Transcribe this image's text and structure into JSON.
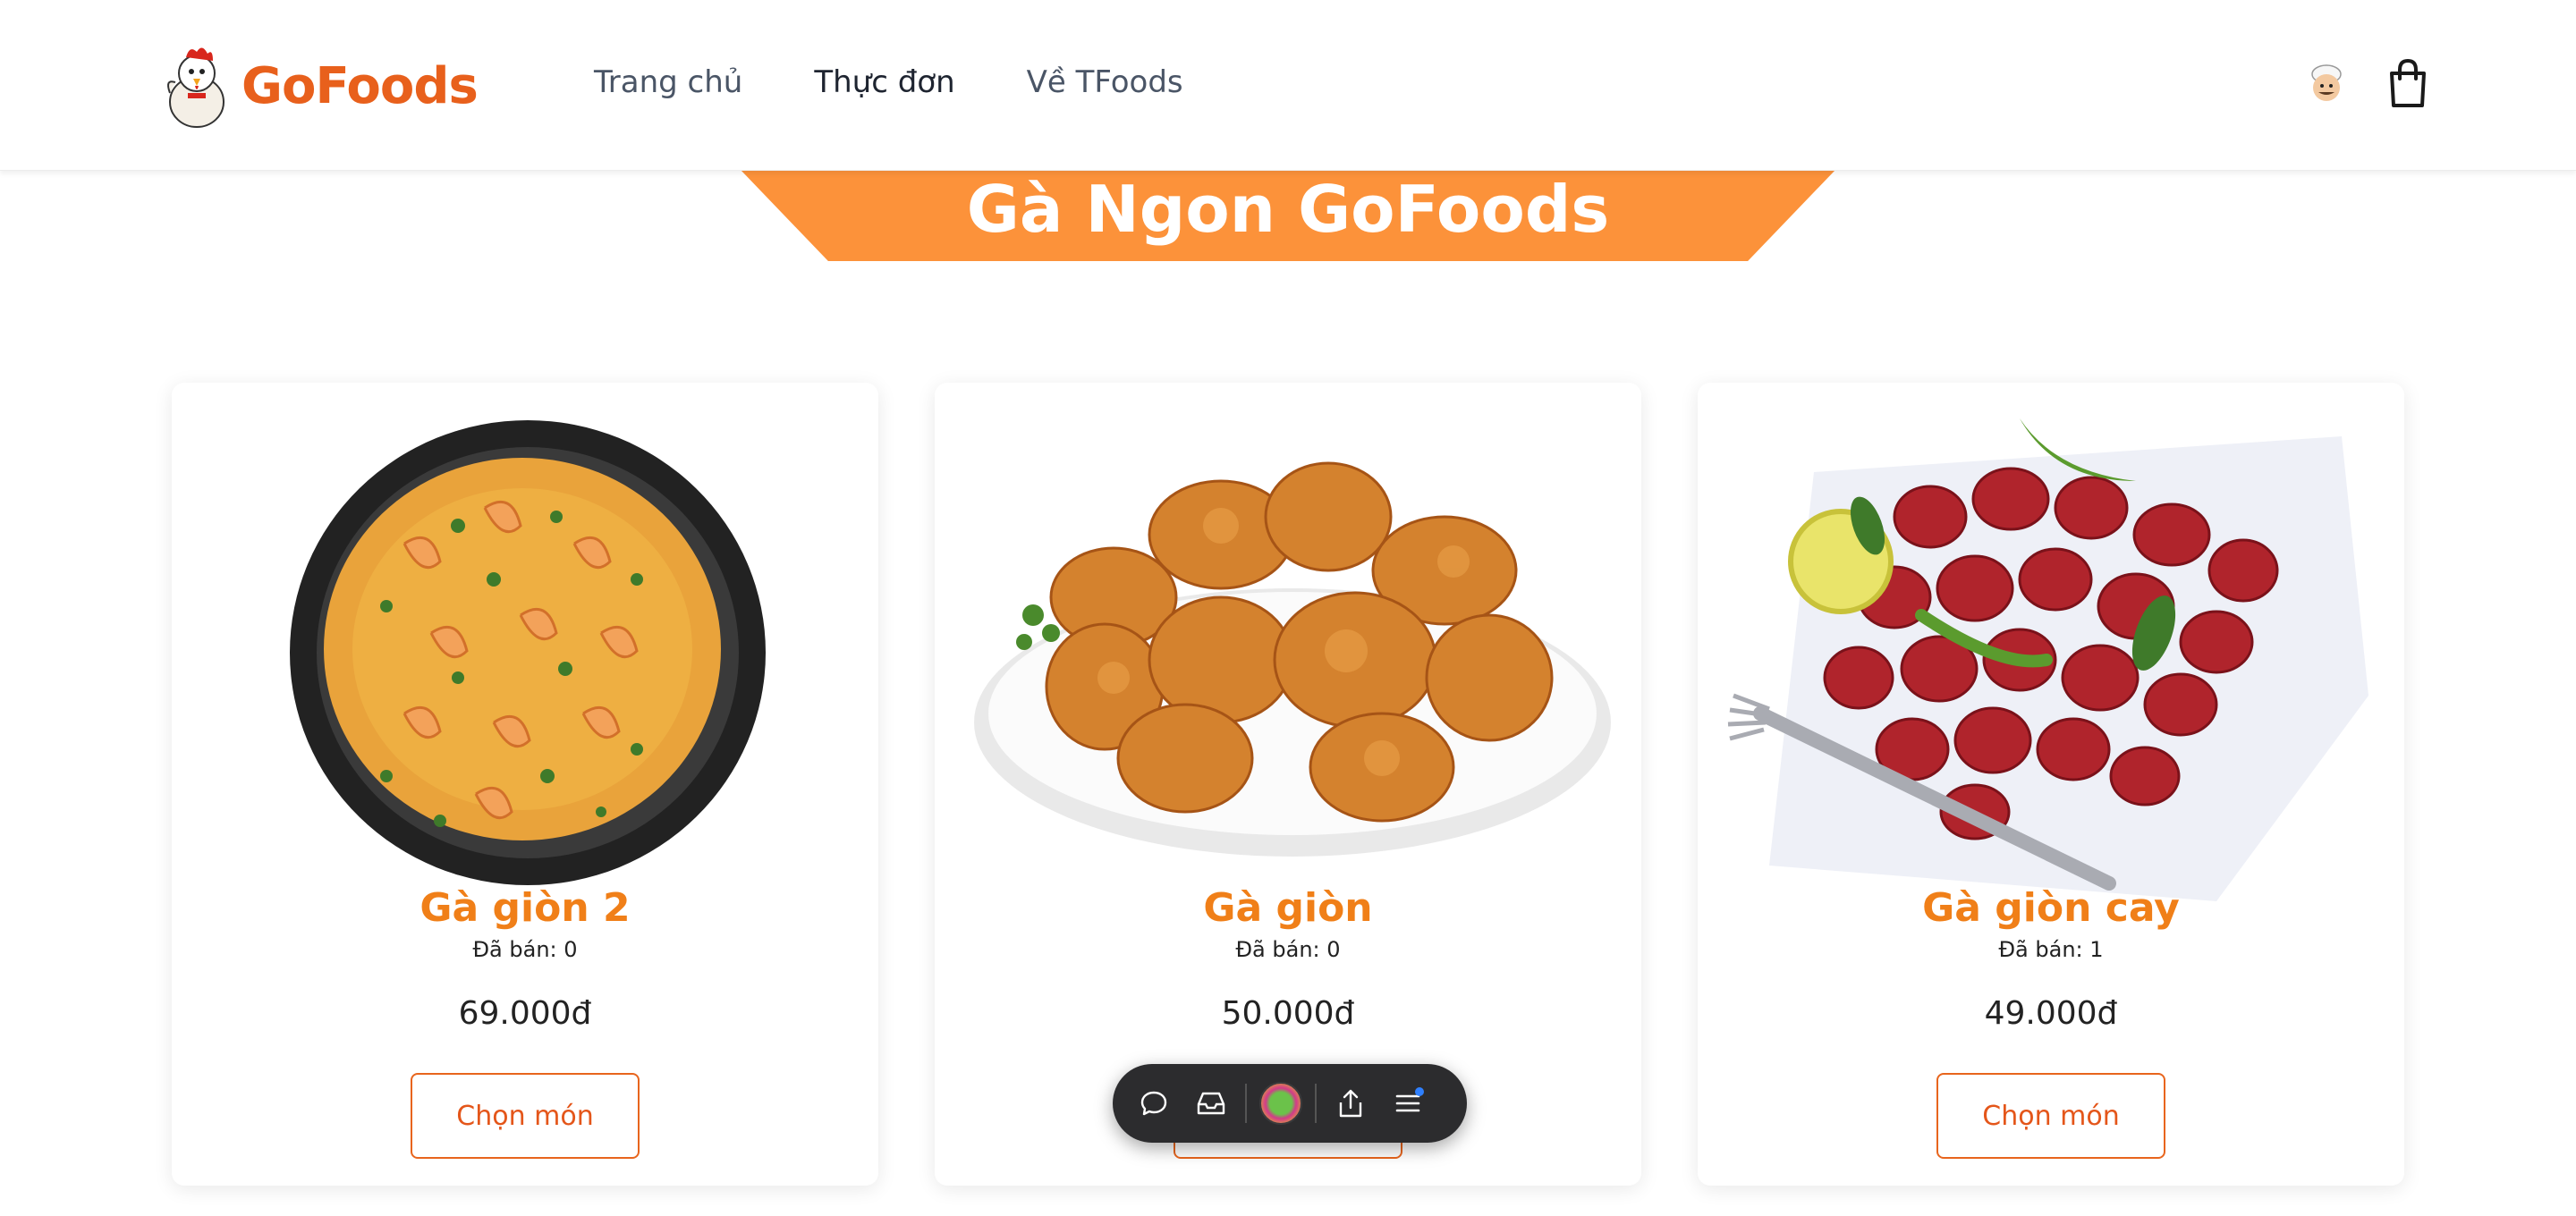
{
  "header": {
    "brand": "GoFoods",
    "nav": [
      {
        "label": "Trang chủ"
      },
      {
        "label": "Thực đơn"
      },
      {
        "label": "Về TFoods"
      }
    ]
  },
  "banner": {
    "title": "Gà Ngon GoFoods"
  },
  "products": [
    {
      "name": "Gà giòn 2",
      "sold": "Đã bán: 0",
      "price": "69.000đ",
      "button": "Chọn món",
      "image": "shrimp-curry-pan"
    },
    {
      "name": "Gà giòn",
      "sold": "Đã bán: 0",
      "price": "50.000đ",
      "button": "Chọn món",
      "image": "fried-chicken-plate"
    },
    {
      "name": "Gà giòn cay",
      "sold": "Đã bán: 1",
      "price": "49.000đ",
      "button": "Chọn món",
      "image": "spicy-chicken-plate"
    }
  ],
  "toolbar": {
    "items": [
      "chat-icon",
      "inbox-icon",
      "profile-avatar",
      "share-icon",
      "menu-icon"
    ]
  },
  "colors": {
    "brand": "#e8601c",
    "banner": "#fc923a",
    "product_name": "#f07f18",
    "button_border": "#e8651d"
  }
}
